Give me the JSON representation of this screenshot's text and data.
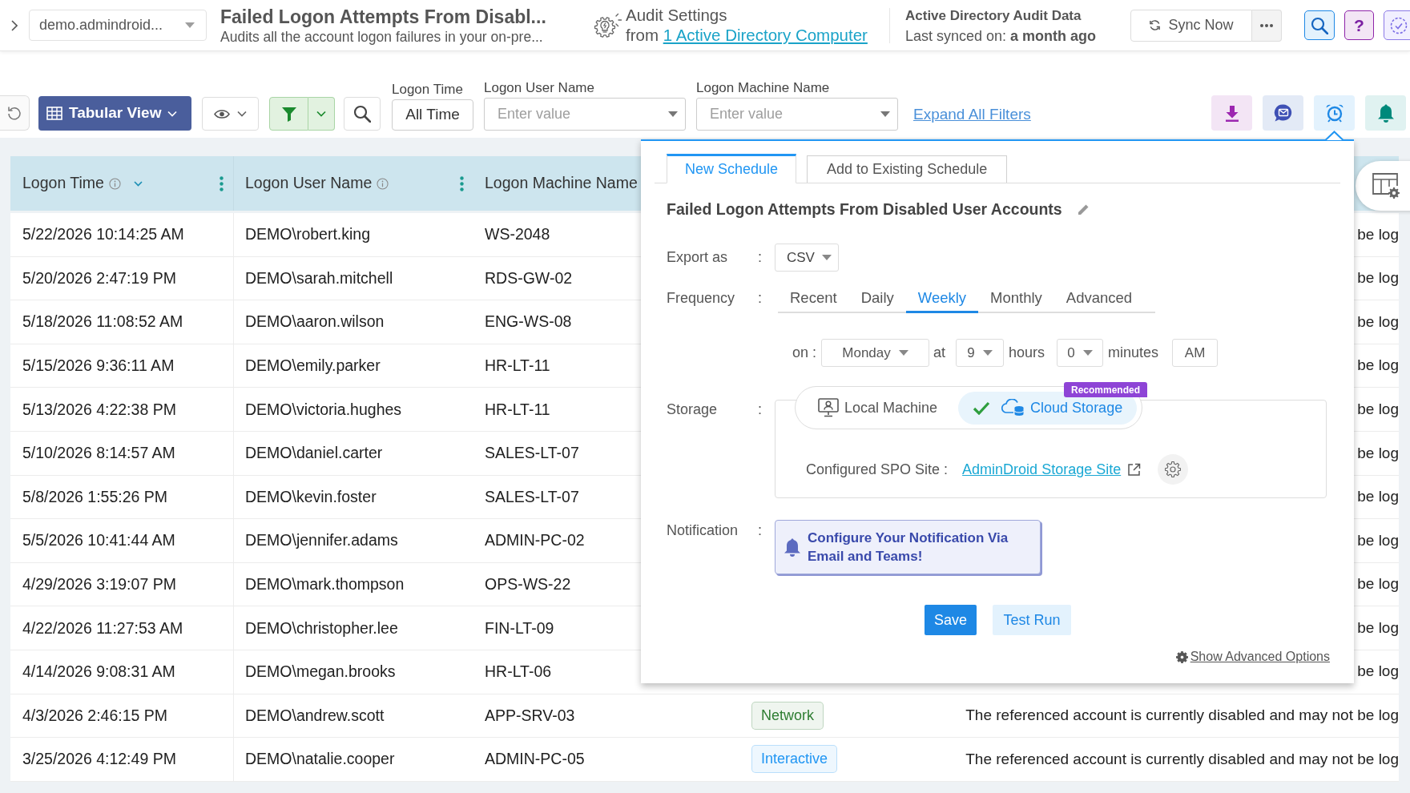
{
  "header": {
    "domain": "demo.admindroid...",
    "title": "Failed Logon Attempts From Disabl...",
    "description": "Audits all the account logon failures in your on-pre...",
    "audit_settings": {
      "title": "Audit Settings",
      "prefix": "from",
      "link": "1 Active Directory Computer"
    },
    "audit_data": {
      "title": "Active Directory Audit Data",
      "last_synced": "Last synced on: **a month ago**"
    },
    "sync_button": "Sync Now",
    "help_button": "?"
  },
  "toolbar": {
    "view_button": "Tabular View",
    "filters": [
      {
        "label": "Logon Time",
        "kind": "button",
        "value": "All Time"
      },
      {
        "label": "Logon User Name",
        "kind": "dropdown",
        "placeholder": "Enter value"
      },
      {
        "label": "Logon Machine Name",
        "kind": "dropdown",
        "placeholder": "Enter value"
      }
    ],
    "expand_link": "Expand All Filters",
    "actions": [
      {
        "kind": "download",
        "selected": false
      },
      {
        "kind": "chat",
        "selected": false
      },
      {
        "kind": "schedule",
        "selected": true
      },
      {
        "kind": "alert",
        "selected": false
      }
    ]
  },
  "table": {
    "columns": [
      {
        "label": "Logon Time",
        "info": true,
        "sorted": true,
        "menu": true
      },
      {
        "label": "Logon User Name",
        "info": true,
        "sorted": false,
        "menu": true
      },
      {
        "label": "Logon Machine Name",
        "info": false,
        "sorted": false,
        "menu": false
      }
    ],
    "rows": [
      {
        "time": "5/22/2026 10:14:25 AM",
        "user": "DEMO\\robert.king",
        "machine": "WS-2048",
        "message": "be log"
      },
      {
        "time": "5/20/2026 2:47:19 PM",
        "user": "DEMO\\sarah.mitchell",
        "machine": "RDS-GW-02",
        "message": "be log"
      },
      {
        "time": "5/18/2026 11:08:52 AM",
        "user": "DEMO\\aaron.wilson",
        "machine": "ENG-WS-08",
        "message": "be log"
      },
      {
        "time": "5/15/2026 9:36:11 AM",
        "user": "DEMO\\emily.parker",
        "machine": "HR-LT-11",
        "message": "be log"
      },
      {
        "time": "5/13/2026 4:22:38 PM",
        "user": "DEMO\\victoria.hughes",
        "machine": "HR-LT-11",
        "message": "be log"
      },
      {
        "time": "5/10/2026 8:14:57 AM",
        "user": "DEMO\\daniel.carter",
        "machine": "SALES-LT-07",
        "message": "be log"
      },
      {
        "time": "5/8/2026 1:55:26 PM",
        "user": "DEMO\\kevin.foster",
        "machine": "SALES-LT-07",
        "message": "be log"
      },
      {
        "time": "5/5/2026 10:41:44 AM",
        "user": "DEMO\\jennifer.adams",
        "machine": "ADMIN-PC-02",
        "message": "be log"
      },
      {
        "time": "4/29/2026 3:19:07 PM",
        "user": "DEMO\\mark.thompson",
        "machine": "OPS-WS-22",
        "message": "be log"
      },
      {
        "time": "4/22/2026 11:27:53 AM",
        "user": "DEMO\\christopher.lee",
        "machine": "FIN-LT-09",
        "message": "be log"
      },
      {
        "time": "4/14/2026 9:08:31 AM",
        "user": "DEMO\\megan.brooks",
        "machine": "HR-LT-06",
        "message": "be log"
      },
      {
        "time": "4/3/2026 2:46:15 PM",
        "user": "DEMO\\andrew.scott",
        "machine": "APP-SRV-03",
        "logon_type": {
          "label": "Network",
          "color": "#2e7d32"
        },
        "message": "The referenced account is currently disabled and may not be log"
      },
      {
        "time": "3/25/2026 4:12:49 PM",
        "user": "DEMO\\natalie.cooper",
        "machine": "ADMIN-PC-05",
        "logon_type": {
          "label": "Interactive",
          "color": "#2196f3"
        },
        "message": "The referenced account is currently disabled and may not be log"
      }
    ]
  },
  "schedule_popup": {
    "tabs": [
      {
        "label": "New Schedule",
        "selected": true
      },
      {
        "label": "Add to Existing Schedule",
        "selected": false
      }
    ],
    "title": "Failed Logon Attempts From Disabled User Accounts",
    "export": {
      "label": "Export as",
      "separator": ":",
      "value": "CSV"
    },
    "frequency": {
      "label": "Frequency",
      "separator": ":",
      "options": [
        {
          "label": "Recent",
          "selected": false
        },
        {
          "label": "Daily",
          "selected": false
        },
        {
          "label": "Weekly",
          "selected": true
        },
        {
          "label": "Monthly",
          "selected": false
        },
        {
          "label": "Advanced",
          "selected": false
        }
      ]
    },
    "weekly": {
      "on_label": "on :",
      "day": "Monday",
      "at_label": "at",
      "hour": "9",
      "hours_label": "hours",
      "minute": "0",
      "minutes_label": "minutes",
      "period": "AM"
    },
    "storage": {
      "label": "Storage",
      "separator": ":",
      "options": [
        {
          "label": "Local Machine",
          "kind": "local",
          "selected": false
        },
        {
          "label": "Cloud Storage",
          "kind": "cloud",
          "selected": true,
          "badge": "Recommended"
        }
      ],
      "site_label": "Configured SPO Site :",
      "site_link": "AdminDroid Storage Site"
    },
    "notification": {
      "label": "Notification",
      "separator": ":",
      "message": "Configure Your Notification Via Email and Teams!"
    },
    "buttons": [
      {
        "label": "Save",
        "kind": "primary"
      },
      {
        "label": "Test Run",
        "kind": "secondary"
      }
    ],
    "advanced_link": "Show Advanced Options"
  }
}
